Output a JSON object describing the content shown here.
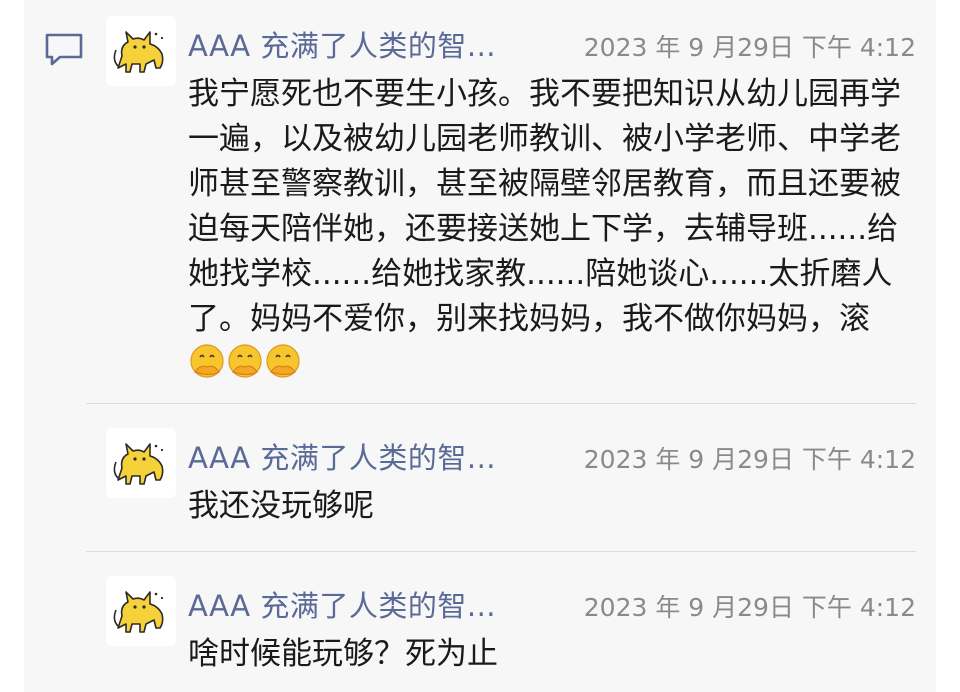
{
  "icons": {
    "comment": "comment-bubble-icon",
    "avatar": "yellow-cat-avatar",
    "emoji": "face-with-hand-over-mouth"
  },
  "colors": {
    "name": "#5a6a96",
    "time": "#8a8a8a",
    "text": "#1a1a1a",
    "panel_bg": "#f7f7f7",
    "cat": "#f5d23a"
  },
  "comments": [
    {
      "author": "AAA 充满了人类的智...",
      "timestamp": "2023 年 9 月29日 下午 4:12",
      "text": "我宁愿死也不要生小孩。我不要把知识从幼儿园再学一遍，以及被幼儿园老师教训、被小学老师、中学老师甚至警察教训，甚至被隔壁邻居教育，而且还要被迫每天陪伴她，还要接送她上下学，去辅导班......给她找学校......给她找家教......陪她谈心......太折磨人了。妈妈不爱你，别来找妈妈，我不做你妈妈，滚",
      "emoji_count": 3
    },
    {
      "author": "AAA 充满了人类的智...",
      "timestamp": "2023 年 9 月29日 下午 4:12",
      "text": "我还没玩够呢"
    },
    {
      "author": "AAA 充满了人类的智...",
      "timestamp": "2023 年 9 月29日 下午 4:12",
      "text": "啥时候能玩够？死为止"
    }
  ]
}
